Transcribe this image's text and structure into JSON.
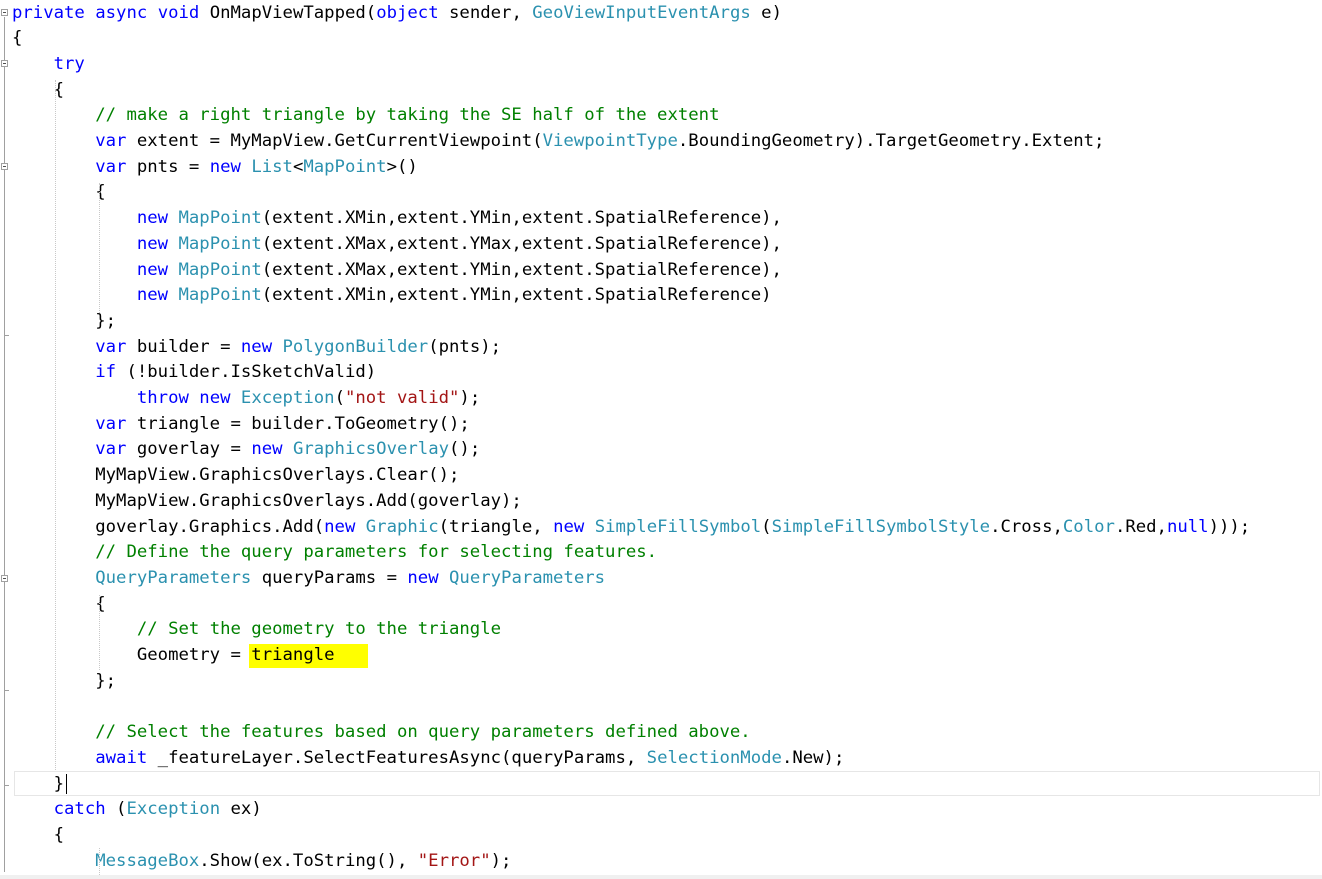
{
  "editor": {
    "language": "C#",
    "colors": {
      "keyword": "#0000ff",
      "type": "#2b91af",
      "comment": "#008000",
      "string": "#a31515",
      "plain": "#000000",
      "highlight": "#ffff00"
    },
    "lines": [
      [
        {
          "t": "private",
          "c": "kw"
        },
        {
          "t": " ",
          "c": "pl"
        },
        {
          "t": "async",
          "c": "kw"
        },
        {
          "t": " ",
          "c": "pl"
        },
        {
          "t": "void",
          "c": "kw"
        },
        {
          "t": " OnMapViewTapped(",
          "c": "pl"
        },
        {
          "t": "object",
          "c": "kw"
        },
        {
          "t": " sender, ",
          "c": "pl"
        },
        {
          "t": "GeoViewInputEventArgs",
          "c": "ty"
        },
        {
          "t": " e)",
          "c": "pl"
        }
      ],
      [
        {
          "t": "{",
          "c": "pl"
        }
      ],
      [
        {
          "t": "    ",
          "c": "pl"
        },
        {
          "t": "try",
          "c": "kw"
        }
      ],
      [
        {
          "t": "    {",
          "c": "pl"
        }
      ],
      [
        {
          "t": "        ",
          "c": "pl"
        },
        {
          "t": "// make a right triangle by taking the SE half of the extent",
          "c": "cm"
        }
      ],
      [
        {
          "t": "        ",
          "c": "pl"
        },
        {
          "t": "var",
          "c": "kw"
        },
        {
          "t": " extent = MyMapView.GetCurrentViewpoint(",
          "c": "pl"
        },
        {
          "t": "ViewpointType",
          "c": "ty"
        },
        {
          "t": ".BoundingGeometry).TargetGeometry.Extent;",
          "c": "pl"
        }
      ],
      [
        {
          "t": "        ",
          "c": "pl"
        },
        {
          "t": "var",
          "c": "kw"
        },
        {
          "t": " pnts = ",
          "c": "pl"
        },
        {
          "t": "new",
          "c": "kw"
        },
        {
          "t": " ",
          "c": "pl"
        },
        {
          "t": "List",
          "c": "ty"
        },
        {
          "t": "<",
          "c": "pl"
        },
        {
          "t": "MapPoint",
          "c": "ty"
        },
        {
          "t": ">()",
          "c": "pl"
        }
      ],
      [
        {
          "t": "        {",
          "c": "pl"
        }
      ],
      [
        {
          "t": "            ",
          "c": "pl"
        },
        {
          "t": "new",
          "c": "kw"
        },
        {
          "t": " ",
          "c": "pl"
        },
        {
          "t": "MapPoint",
          "c": "ty"
        },
        {
          "t": "(extent.XMin,extent.YMin,extent.SpatialReference),",
          "c": "pl"
        }
      ],
      [
        {
          "t": "            ",
          "c": "pl"
        },
        {
          "t": "new",
          "c": "kw"
        },
        {
          "t": " ",
          "c": "pl"
        },
        {
          "t": "MapPoint",
          "c": "ty"
        },
        {
          "t": "(extent.XMax,extent.YMax,extent.SpatialReference),",
          "c": "pl"
        }
      ],
      [
        {
          "t": "            ",
          "c": "pl"
        },
        {
          "t": "new",
          "c": "kw"
        },
        {
          "t": " ",
          "c": "pl"
        },
        {
          "t": "MapPoint",
          "c": "ty"
        },
        {
          "t": "(extent.XMax,extent.YMin,extent.SpatialReference),",
          "c": "pl"
        }
      ],
      [
        {
          "t": "            ",
          "c": "pl"
        },
        {
          "t": "new",
          "c": "kw"
        },
        {
          "t": " ",
          "c": "pl"
        },
        {
          "t": "MapPoint",
          "c": "ty"
        },
        {
          "t": "(extent.XMin,extent.YMin,extent.SpatialReference)",
          "c": "pl"
        }
      ],
      [
        {
          "t": "        };",
          "c": "pl"
        }
      ],
      [
        {
          "t": "        ",
          "c": "pl"
        },
        {
          "t": "var",
          "c": "kw"
        },
        {
          "t": " builder = ",
          "c": "pl"
        },
        {
          "t": "new",
          "c": "kw"
        },
        {
          "t": " ",
          "c": "pl"
        },
        {
          "t": "PolygonBuilder",
          "c": "ty"
        },
        {
          "t": "(pnts);",
          "c": "pl"
        }
      ],
      [
        {
          "t": "        ",
          "c": "pl"
        },
        {
          "t": "if",
          "c": "kw"
        },
        {
          "t": " (!builder.IsSketchValid)",
          "c": "pl"
        }
      ],
      [
        {
          "t": "            ",
          "c": "pl"
        },
        {
          "t": "throw",
          "c": "kw"
        },
        {
          "t": " ",
          "c": "pl"
        },
        {
          "t": "new",
          "c": "kw"
        },
        {
          "t": " ",
          "c": "pl"
        },
        {
          "t": "Exception",
          "c": "ty"
        },
        {
          "t": "(",
          "c": "pl"
        },
        {
          "t": "\"not valid\"",
          "c": "st"
        },
        {
          "t": ");",
          "c": "pl"
        }
      ],
      [
        {
          "t": "        ",
          "c": "pl"
        },
        {
          "t": "var",
          "c": "kw"
        },
        {
          "t": " triangle = builder.ToGeometry();",
          "c": "pl"
        }
      ],
      [
        {
          "t": "        ",
          "c": "pl"
        },
        {
          "t": "var",
          "c": "kw"
        },
        {
          "t": " goverlay = ",
          "c": "pl"
        },
        {
          "t": "new",
          "c": "kw"
        },
        {
          "t": " ",
          "c": "pl"
        },
        {
          "t": "GraphicsOverlay",
          "c": "ty"
        },
        {
          "t": "();",
          "c": "pl"
        }
      ],
      [
        {
          "t": "        MyMapView.GraphicsOverlays.Clear();",
          "c": "pl"
        }
      ],
      [
        {
          "t": "        MyMapView.GraphicsOverlays.Add(goverlay);",
          "c": "pl"
        }
      ],
      [
        {
          "t": "        goverlay.Graphics.Add(",
          "c": "pl"
        },
        {
          "t": "new",
          "c": "kw"
        },
        {
          "t": " ",
          "c": "pl"
        },
        {
          "t": "Graphic",
          "c": "ty"
        },
        {
          "t": "(triangle, ",
          "c": "pl"
        },
        {
          "t": "new",
          "c": "kw"
        },
        {
          "t": " ",
          "c": "pl"
        },
        {
          "t": "SimpleFillSymbol",
          "c": "ty"
        },
        {
          "t": "(",
          "c": "pl"
        },
        {
          "t": "SimpleFillSymbolStyle",
          "c": "ty"
        },
        {
          "t": ".Cross,",
          "c": "pl"
        },
        {
          "t": "Color",
          "c": "ty"
        },
        {
          "t": ".Red,",
          "c": "pl"
        },
        {
          "t": "null",
          "c": "kw"
        },
        {
          "t": ")));",
          "c": "pl"
        }
      ],
      [
        {
          "t": "        ",
          "c": "pl"
        },
        {
          "t": "// Define the query parameters for selecting features.",
          "c": "cm"
        }
      ],
      [
        {
          "t": "        ",
          "c": "pl"
        },
        {
          "t": "QueryParameters",
          "c": "ty"
        },
        {
          "t": " queryParams = ",
          "c": "pl"
        },
        {
          "t": "new",
          "c": "kw"
        },
        {
          "t": " ",
          "c": "pl"
        },
        {
          "t": "QueryParameters",
          "c": "ty"
        }
      ],
      [
        {
          "t": "        {",
          "c": "pl"
        }
      ],
      [
        {
          "t": "            ",
          "c": "pl"
        },
        {
          "t": "// Set the geometry to the triangle",
          "c": "cm"
        }
      ],
      [
        {
          "t": "            Geometry = triangle",
          "c": "pl"
        }
      ],
      [
        {
          "t": "        };",
          "c": "pl"
        }
      ],
      [],
      [
        {
          "t": "        ",
          "c": "pl"
        },
        {
          "t": "// Select the features based on query parameters defined above.",
          "c": "cm"
        }
      ],
      [
        {
          "t": "        ",
          "c": "pl"
        },
        {
          "t": "await",
          "c": "kw"
        },
        {
          "t": " _featureLayer.SelectFeaturesAsync(queryParams, ",
          "c": "pl"
        },
        {
          "t": "SelectionMode",
          "c": "ty"
        },
        {
          "t": ".New);",
          "c": "pl"
        }
      ],
      [
        {
          "t": "    }",
          "c": "pl"
        }
      ],
      [
        {
          "t": "    ",
          "c": "pl"
        },
        {
          "t": "catch",
          "c": "kw"
        },
        {
          "t": " (",
          "c": "pl"
        },
        {
          "t": "Exception",
          "c": "ty"
        },
        {
          "t": " ex)",
          "c": "pl"
        }
      ],
      [
        {
          "t": "    {",
          "c": "pl"
        }
      ],
      [
        {
          "t": "        ",
          "c": "pl"
        },
        {
          "t": "MessageBox",
          "c": "ty"
        },
        {
          "t": ".Show(ex.ToString(), ",
          "c": "pl"
        },
        {
          "t": "\"Error\"",
          "c": "st"
        },
        {
          "t": ");",
          "c": "pl"
        }
      ]
    ]
  }
}
